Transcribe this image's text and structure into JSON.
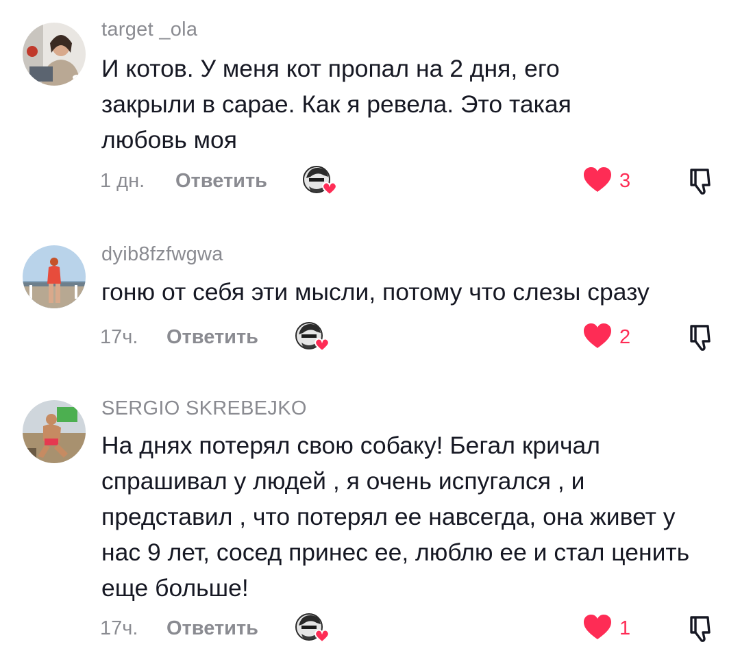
{
  "comments": [
    {
      "username": "target _ola",
      "text": "И котов. У меня кот пропал на 2 дня, его закрыли в сарае. Как я ревела. Это такая любовь моя",
      "time": "1 дн.",
      "reply_label": "Ответить",
      "likes": "3"
    },
    {
      "username": "dyib8fzfwgwa",
      "text": "гоню от себя эти мысли, потому что слезы сразу",
      "time": "17ч.",
      "reply_label": "Ответить",
      "likes": "2"
    },
    {
      "username": "SERGIO SKREBEJKO",
      "text": "На днях потерял свою собаку! Бегал кричал спрашивал у людей , я очень испугался , и представил , что потерял ее навсегда, она живет у нас 9 лет, сосед принес ее, люблю ее и стал ценить еще больше!",
      "time": "17ч.",
      "reply_label": "Ответить",
      "likes": "1"
    }
  ],
  "colors": {
    "accent_like": "#fe2c55",
    "secondary_text": "#8a8b91",
    "primary_text": "#161823"
  },
  "icons": {
    "like": "heart-filled-icon",
    "dislike": "thumbs-down-icon",
    "creator_liked": "creator-avatar-heart-icon"
  }
}
